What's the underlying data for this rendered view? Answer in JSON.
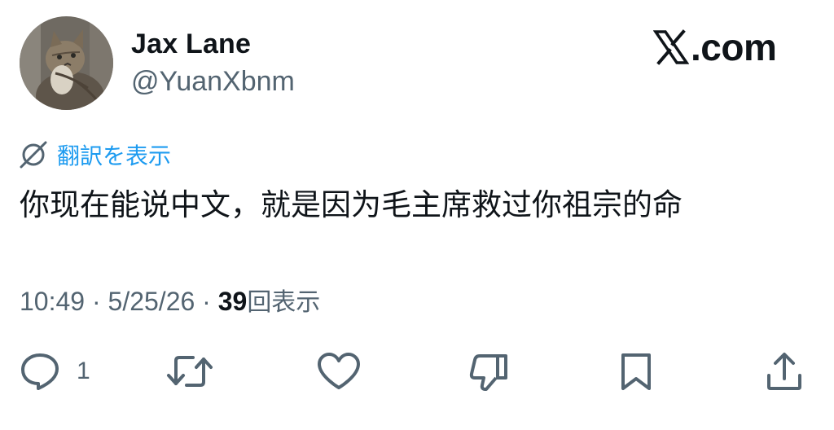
{
  "author": {
    "display_name": "Jax Lane",
    "handle": "@YuanXbnm",
    "avatar_icon": "cat-avatar"
  },
  "site": {
    "logo_icon": "x-logo-icon",
    "domain_text": ".com"
  },
  "translate": {
    "icon": "globe-icon",
    "label": "翻訳を表示",
    "color": "#1d9bf0"
  },
  "tweet": {
    "text": "你现在能说中文，就是因为毛主席救过你祖宗的命"
  },
  "meta": {
    "time": "10:49",
    "separator": " · ",
    "date": "5/25/26",
    "views_count": "39",
    "views_label": "回表示"
  },
  "actions": {
    "reply": {
      "icon": "reply-icon",
      "count": "1"
    },
    "repost": {
      "icon": "repost-icon"
    },
    "like": {
      "icon": "heart-icon"
    },
    "dislike": {
      "icon": "thumbs-down-icon"
    },
    "bookmark": {
      "icon": "bookmark-icon"
    },
    "share": {
      "icon": "share-icon"
    }
  },
  "colors": {
    "text": "#0f1419",
    "secondary": "#536471",
    "accent": "#1d9bf0",
    "background": "#ffffff"
  }
}
